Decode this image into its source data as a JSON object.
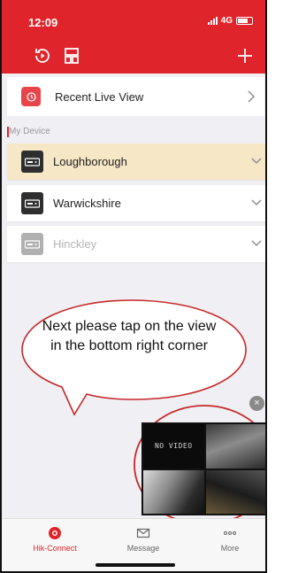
{
  "status_bar": {
    "time": "12:09",
    "network": "4G"
  },
  "recent_live_view": {
    "label": "Recent Live View"
  },
  "section": {
    "title": "My Device"
  },
  "devices": [
    {
      "name": "Loughborough",
      "state": "selected"
    },
    {
      "name": "Warwickshire",
      "state": "normal"
    },
    {
      "name": "Hinckley",
      "state": "offline"
    }
  ],
  "callout": {
    "text": "Next please tap on the view in the bottom right corner"
  },
  "preview": {
    "tile_text": "NO VIDEO",
    "close_icon": "×"
  },
  "bottom_nav": [
    {
      "label": "Hik-Connect",
      "icon": "hik-connect-icon",
      "active": true
    },
    {
      "label": "Message",
      "icon": "message-icon",
      "active": false
    },
    {
      "label": "More",
      "icon": "more-icon",
      "active": false
    }
  ],
  "colors": {
    "brand_red": "#e0242b",
    "selected_row": "#f6e7c6",
    "callout_outline": "#c62828"
  }
}
